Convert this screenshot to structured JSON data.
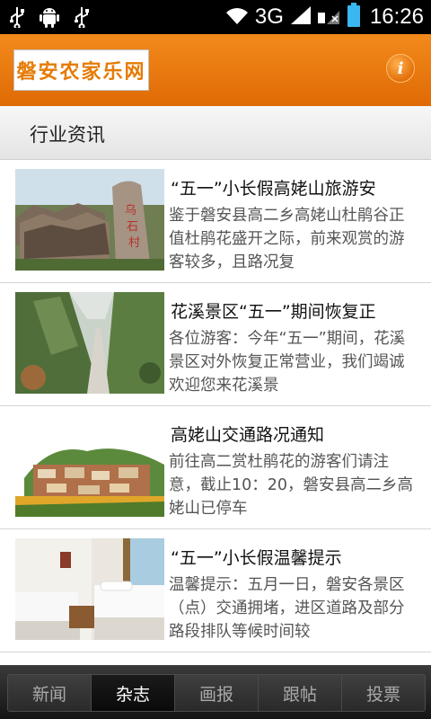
{
  "status_bar": {
    "network_label": "3G",
    "clock": "16:26"
  },
  "header": {
    "logo_text": "磐安农家乐网",
    "info_icon_glyph": "i"
  },
  "section": {
    "title": "行业资讯"
  },
  "articles": [
    {
      "title": "“五一”小长假高姥山旅游安",
      "summary": "鉴于磐安县高二乡高姥山杜鹃谷正值杜鹃花盛开之际，前来观赏的游客较多，且路况复",
      "thumb_icon": "village-rock-photo"
    },
    {
      "title": "花溪景区“五一”期间恢复正",
      "summary": "各位游客：今年“五一”期间，花溪景区对外恢复正常营业，我们竭诚欢迎您来花溪景",
      "thumb_icon": "valley-stream-photo"
    },
    {
      "title": "高姥山交通路况通知",
      "summary": "前往高二赏杜鹃花的游客们请注意，截止10：20，磐安县高二乡高姥山已停车",
      "thumb_icon": "hillside-village-photo"
    },
    {
      "title": "“五一”小长假温馨提示",
      "summary": "温馨提示：五月一日，磐安各景区（点）交通拥堵，进区道路及部分路段排队等候时间较",
      "thumb_icon": "hotel-room-photo"
    }
  ],
  "tabs": [
    {
      "label": "新闻",
      "active": false
    },
    {
      "label": "杂志",
      "active": true
    },
    {
      "label": "画报",
      "active": false
    },
    {
      "label": "跟帖",
      "active": false
    },
    {
      "label": "投票",
      "active": false
    }
  ],
  "colors": {
    "header_orange": "#e97a10",
    "tab_active": "#0f0f0f"
  }
}
